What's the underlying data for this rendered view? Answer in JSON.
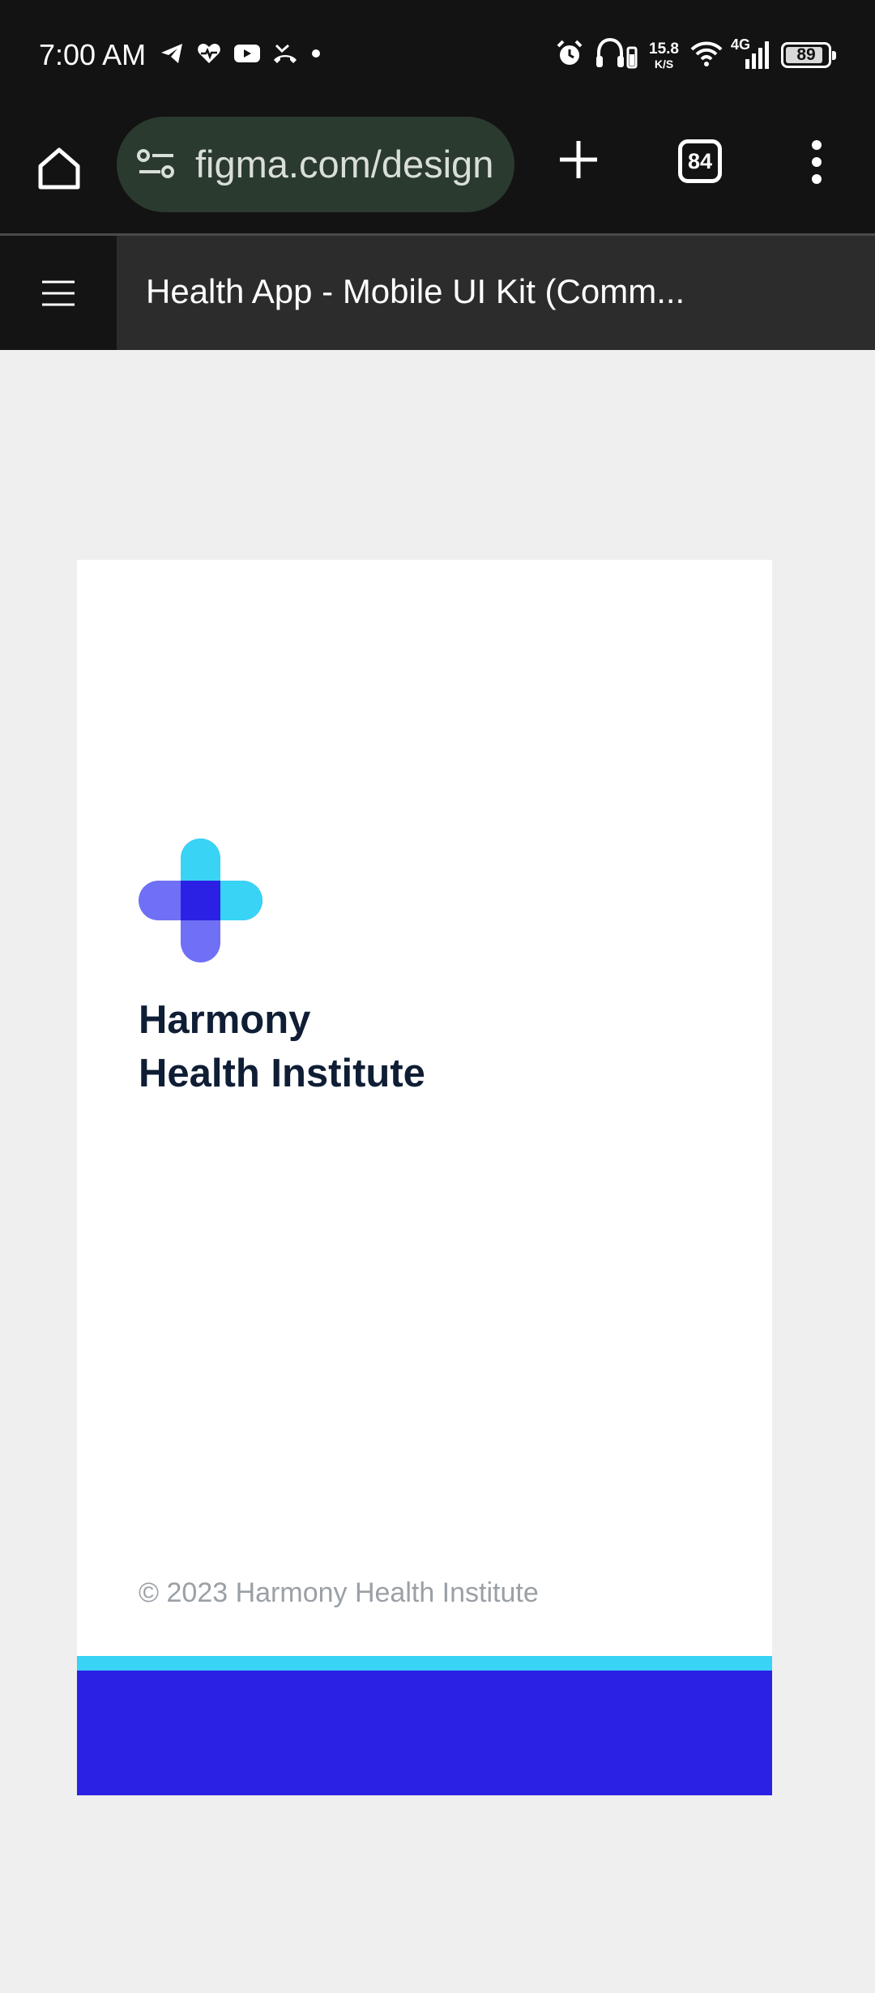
{
  "status_bar": {
    "time": "7:00 AM",
    "left_icons": [
      "telegram-icon",
      "heart-pulse-icon",
      "youtube-icon",
      "missed-call-icon",
      "dot-icon"
    ],
    "speed_value": "15.8",
    "speed_unit": "K/S",
    "network_type": "4G",
    "battery_level": "89",
    "right_icons": [
      "alarm-icon",
      "headphones-icon",
      "wifi-icon",
      "signal-icon",
      "battery-icon"
    ]
  },
  "browser": {
    "url": "figma.com/design",
    "tab_count": "84",
    "icons": [
      "home-icon",
      "site-settings-icon",
      "plus-icon",
      "tabs-icon",
      "more-vert-icon"
    ]
  },
  "figma": {
    "file_title": "Health App - Mobile UI Kit (Comm...",
    "menu_icon": "hamburger-menu-icon"
  },
  "design_frame": {
    "org_name_line1": "Harmony",
    "org_name_line2": "Health Institute",
    "copyright": "© 2023 Harmony Health Institute",
    "colors": {
      "primary_blue": "#2b21e4",
      "accent_cyan": "#38d3f5",
      "logo_violet": "#6f70f5",
      "text_dark": "#0f1e35",
      "text_muted": "#9aa0a6"
    }
  }
}
